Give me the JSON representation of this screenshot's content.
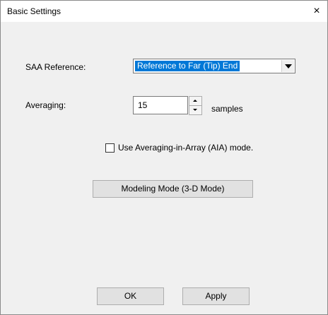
{
  "window": {
    "title": "Basic Settings",
    "close_glyph": "×"
  },
  "saa_reference": {
    "label": "SAA Reference:",
    "selected": "Reference to Far (Tip) End"
  },
  "averaging": {
    "label": "Averaging:",
    "value": "15",
    "unit": "samples"
  },
  "aia_mode": {
    "label": "Use Averaging-in-Array (AIA) mode.",
    "checked": false
  },
  "buttons": {
    "modeling_mode": "Modeling Mode (3-D Mode)",
    "ok": "OK",
    "apply": "Apply"
  },
  "icons": {
    "close": "close-icon",
    "dropdown": "chevron-down-icon",
    "spin_up": "spin-up-icon",
    "spin_down": "spin-down-icon"
  },
  "colors": {
    "selection": "#0078d7",
    "dialog_bg": "#f0f0f0",
    "button_bg": "#e1e1e1"
  }
}
